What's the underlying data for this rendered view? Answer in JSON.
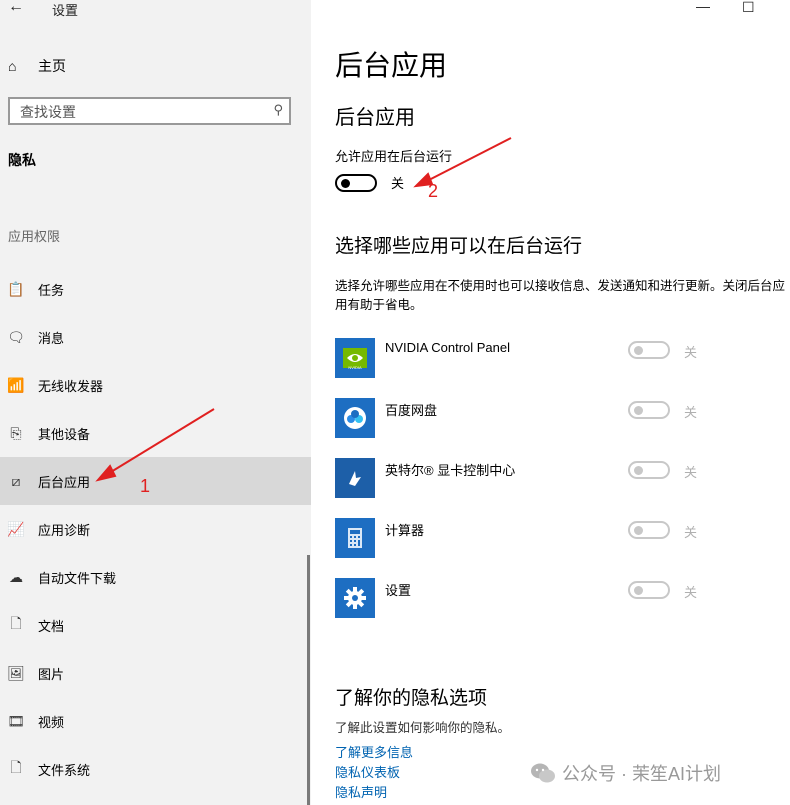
{
  "window": {
    "title": "设置",
    "minimize_glyph": "—",
    "maximize_glyph": "☐"
  },
  "sidebar": {
    "home_label": "主页",
    "search_placeholder": "查找设置",
    "privacy_heading": "隐私",
    "permissions_heading": "应用权限",
    "items": [
      {
        "label": "任务",
        "icon": "clipboard-icon",
        "glyph": "📋"
      },
      {
        "label": "消息",
        "icon": "message-icon",
        "glyph": "🗨"
      },
      {
        "label": "无线收发器",
        "icon": "antenna-icon",
        "glyph": "📶"
      },
      {
        "label": "其他设备",
        "icon": "devices-icon",
        "glyph": "⎘"
      },
      {
        "label": "后台应用",
        "icon": "background-apps-icon",
        "glyph": "⧄",
        "active": true
      },
      {
        "label": "应用诊断",
        "icon": "diagnostics-icon",
        "glyph": "📈"
      },
      {
        "label": "自动文件下载",
        "icon": "cloud-icon",
        "glyph": "☁"
      },
      {
        "label": "文档",
        "icon": "document-icon",
        "glyph": "🗋"
      },
      {
        "label": "图片",
        "icon": "picture-icon",
        "glyph": "🖼"
      },
      {
        "label": "视频",
        "icon": "video-icon",
        "glyph": "🎞"
      },
      {
        "label": "文件系统",
        "icon": "file-system-icon",
        "glyph": "🗋"
      }
    ]
  },
  "main": {
    "page_title": "后台应用",
    "section1_title": "后台应用",
    "allow_label": "允许应用在后台运行",
    "allow_state": "关",
    "section2_title": "选择哪些应用可以在后台运行",
    "section2_desc": "选择允许哪些应用在不使用时也可以接收信息、发送通知和进行更新。关闭后台应用有助于省电。",
    "apps": [
      {
        "name": "NVIDIA Control Panel",
        "state": "关",
        "icon": "nvidia-icon",
        "color": "#76b900"
      },
      {
        "name": "百度网盘",
        "state": "关",
        "icon": "baidu-netdisk-icon",
        "color": "#1d6ec2"
      },
      {
        "name": "英特尔® 显卡控制中心",
        "state": "关",
        "icon": "intel-graphics-icon",
        "color": "#1d5fa8"
      },
      {
        "name": "计算器",
        "state": "关",
        "icon": "calculator-icon",
        "color": "#1d6ec2"
      },
      {
        "name": "设置",
        "state": "关",
        "icon": "gear-icon",
        "color": "#1d6ec2"
      }
    ],
    "privacy_title": "了解你的隐私选项",
    "privacy_desc": "了解此设置如何影响你的隐私。",
    "links": [
      "了解更多信息",
      "隐私仪表板",
      "隐私声明"
    ]
  },
  "annotations": {
    "label1": "1",
    "label2": "2",
    "arrow_color": "#e02020"
  },
  "watermark": {
    "text": "公众号 · 茉笙AI计划"
  }
}
